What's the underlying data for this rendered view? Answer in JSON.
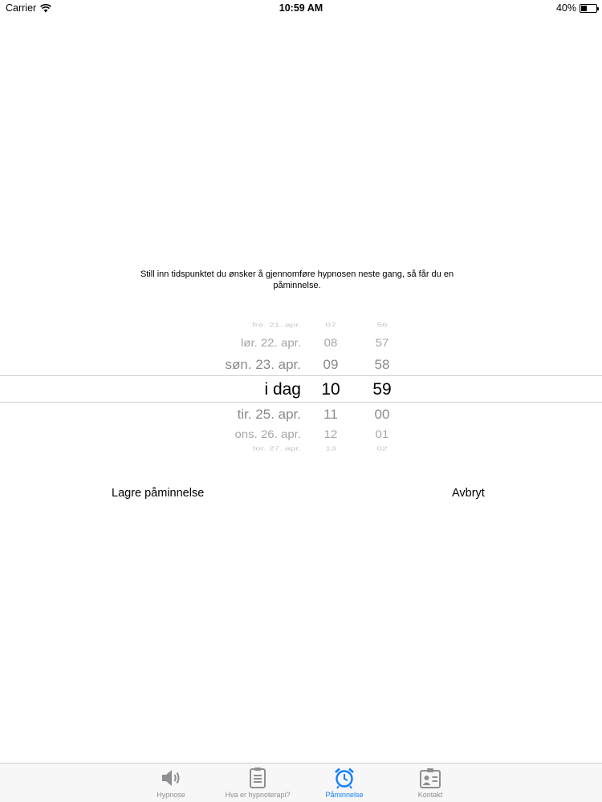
{
  "status_bar": {
    "carrier": "Carrier",
    "time": "10:59 AM",
    "battery": "40%",
    "battery_level": 0.4
  },
  "instruction": "Still inn tidspunktet du ønsker å gjennomføre hypnosen neste gang, så får du en påminnelse.",
  "picker": {
    "rows": [
      {
        "date": "fre. 21. apr.",
        "hour": "07",
        "minute": "56"
      },
      {
        "date": "lør. 22. apr.",
        "hour": "08",
        "minute": "57"
      },
      {
        "date": "søn. 23. apr.",
        "hour": "09",
        "minute": "58"
      },
      {
        "date": "i dag",
        "hour": "10",
        "minute": "59"
      },
      {
        "date": "tir. 25. apr.",
        "hour": "11",
        "minute": "00"
      },
      {
        "date": "ons. 26. apr.",
        "hour": "12",
        "minute": "01"
      },
      {
        "date": "tor. 27. apr.",
        "hour": "13",
        "minute": "02"
      }
    ],
    "selected_index": 3
  },
  "actions": {
    "save_label": "Lagre påminnelse",
    "cancel_label": "Avbryt"
  },
  "tabs": [
    {
      "label": "Hypnose",
      "icon": "speaker-icon",
      "active": false
    },
    {
      "label": "Hva er hypnoterapi?",
      "icon": "clipboard-icon",
      "active": false
    },
    {
      "label": "Påminnelse",
      "icon": "alarm-clock-icon",
      "active": true
    },
    {
      "label": "Kontakt",
      "icon": "contact-card-icon",
      "active": false
    }
  ],
  "colors": {
    "accent": "#147efb",
    "inactive": "#8e8e93",
    "tab_bar_bg": "#f7f7f7"
  }
}
